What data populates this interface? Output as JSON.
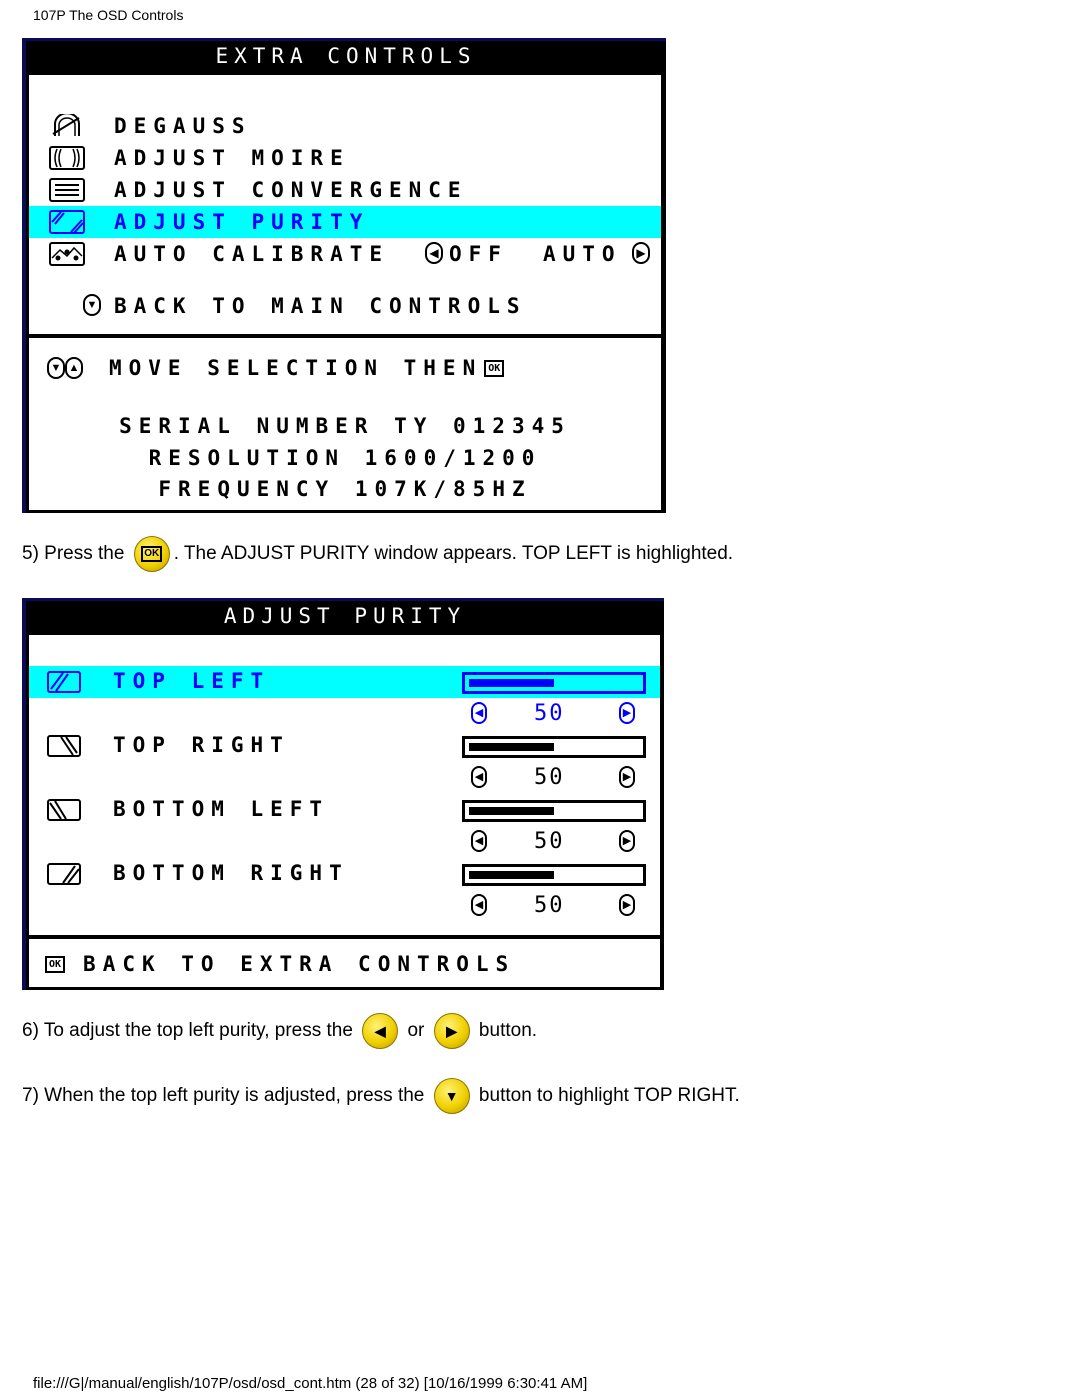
{
  "page": {
    "header": "107P The OSD Controls",
    "footer": "file:///G|/manual/english/107P/osd/osd_cont.htm (28 of 32) [10/16/1999 6:30:41 AM]"
  },
  "extra_controls": {
    "title": "EXTRA CONTROLS",
    "items": [
      {
        "label": "DEGAUSS",
        "icon": "degauss-icon",
        "selected": false
      },
      {
        "label": "ADJUST MOIRE",
        "icon": "moire-icon",
        "selected": false
      },
      {
        "label": "ADJUST CONVERGENCE",
        "icon": "convergence-icon",
        "selected": false
      },
      {
        "label": "ADJUST PURITY",
        "icon": "purity-icon",
        "selected": true
      },
      {
        "label": "AUTO CALIBRATE",
        "icon": "auto-calibrate-icon",
        "selected": false,
        "option_left": "OFF",
        "option_right": "AUTO"
      }
    ],
    "back_label": "BACK TO MAIN CONTROLS",
    "hint": "MOVE SELECTION THEN",
    "hint_ok": "OK",
    "info": {
      "serial": "SERIAL NUMBER TY 012345",
      "resolution": "RESOLUTION 1600/1200",
      "frequency": "FREQUENCY 107K/85HZ"
    }
  },
  "step5": {
    "before": "5) Press the ",
    "button": "OK",
    "after": ". The ADJUST PURITY window appears. TOP LEFT is highlighted."
  },
  "adjust_purity": {
    "title": "ADJUST PURITY",
    "items": [
      {
        "label": "TOP LEFT",
        "value": "50",
        "level_percent": 50,
        "selected": true
      },
      {
        "label": "TOP RIGHT",
        "value": "50",
        "level_percent": 50,
        "selected": false
      },
      {
        "label": "BOTTOM LEFT",
        "value": "50",
        "level_percent": 50,
        "selected": false
      },
      {
        "label": "BOTTOM RIGHT",
        "value": "50",
        "level_percent": 50,
        "selected": false
      }
    ],
    "back_ok": "OK",
    "back_label": "BACK TO EXTRA CONTROLS"
  },
  "step6": {
    "before": "6) To adjust the top left purity, press the ",
    "middle": " or ",
    "after": " button."
  },
  "step7": {
    "before": "7) When the top left purity is adjusted, press the ",
    "after": " button to highlight TOP RIGHT."
  },
  "colors": {
    "highlight": "#00ffff",
    "selected_text": "#0000ff",
    "panel_border": "#0a0a55",
    "button_yellow": "#f0d000"
  }
}
